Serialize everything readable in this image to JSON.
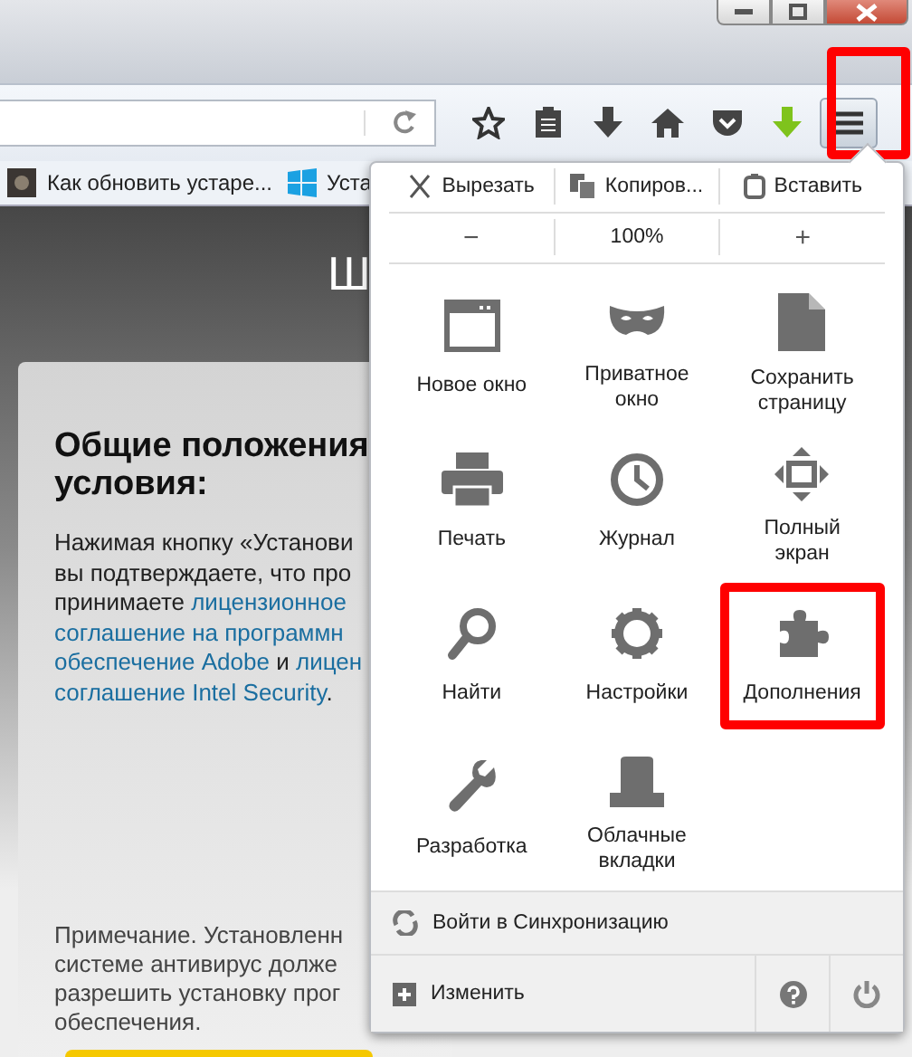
{
  "toolbar": {
    "menu_button": {
      "highlighted": true
    }
  },
  "bookmarks": [
    {
      "label": "Как обновить устаре...",
      "kind": "photo"
    },
    {
      "label": "Уста",
      "kind": "windows"
    }
  ],
  "page": {
    "title_fragment": "Ш",
    "heading": [
      "Общие положения",
      "условия:"
    ],
    "paragraph": [
      [
        {
          "text": "Нажимая кнопку «Установи",
          "link": false
        }
      ],
      [
        {
          "text": "вы подтверждаете, что про",
          "link": false
        }
      ],
      [
        {
          "text": "принимаете ",
          "link": false
        },
        {
          "text": "лицензионное",
          "link": true
        }
      ],
      [
        {
          "text": "соглашение на программн",
          "link": true
        }
      ],
      [
        {
          "text": "обеспечение Adobe",
          "link": true
        },
        {
          "text": " и ",
          "link": false
        },
        {
          "text": "лицен",
          "link": true
        }
      ],
      [
        {
          "text": "соглашение Intel Security",
          "link": true
        },
        {
          "text": ".",
          "link": false
        }
      ]
    ],
    "note": [
      "Примечание. Установленн",
      "системе антивирус долже",
      "разрешить установку прог",
      "обеспечения."
    ]
  },
  "menu": {
    "edit": [
      "Вырезать",
      "Копиров...",
      "Вставить"
    ],
    "zoom": {
      "out": "−",
      "level": "100%",
      "in": "+"
    },
    "items": [
      {
        "label": "Новое окно",
        "highlighted": false
      },
      {
        "label": "Приватное окно",
        "highlighted": false
      },
      {
        "label": "Сохранить страницу",
        "highlighted": false
      },
      {
        "label": "Печать",
        "highlighted": false
      },
      {
        "label": "Журнал",
        "highlighted": false
      },
      {
        "label": "Полный экран",
        "highlighted": false
      },
      {
        "label": "Найти",
        "highlighted": false
      },
      {
        "label": "Настройки",
        "highlighted": false
      },
      {
        "label": "Дополнения",
        "highlighted": true
      },
      {
        "label": "Разработка",
        "highlighted": false
      },
      {
        "label": "Облачные вкладки",
        "highlighted": false
      }
    ],
    "sync": "Войти в Синхронизацию",
    "customize": "Изменить"
  }
}
